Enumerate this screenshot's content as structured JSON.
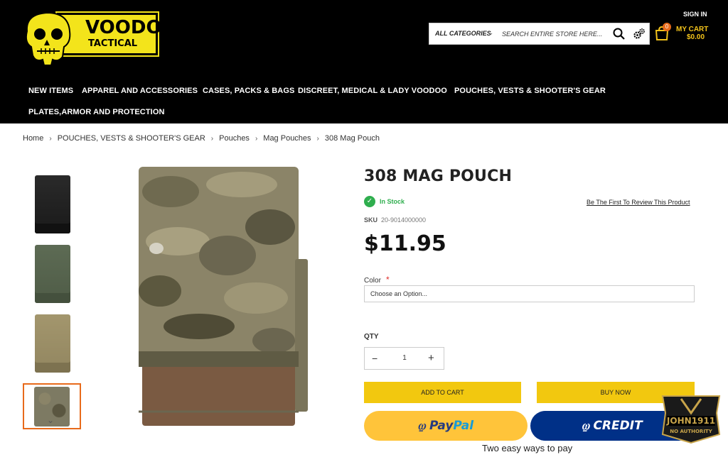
{
  "header": {
    "logo_line1": "VOODOO",
    "logo_line2": "TACTICAL",
    "search_category": "ALL CATEGORIES",
    "search_placeholder": "SEARCH ENTIRE STORE HERE...",
    "sign_in": "SIGN IN",
    "cart_count": "0",
    "cart_label": "MY CART",
    "cart_total": "$0.00"
  },
  "nav": [
    "NEW ITEMS",
    "APPAREL AND ACCESSORIES",
    "CASES, PACKS & BAGS",
    "DISCREET, MEDICAL & LADY VOODOO",
    "POUCHES, VESTS & SHOOTER'S GEAR",
    "PLATES,ARMOR AND PROTECTION"
  ],
  "breadcrumb": [
    "Home",
    "POUCHES, VESTS & SHOOTER'S GEAR",
    "Pouches",
    "Mag Pouches",
    "308 Mag Pouch"
  ],
  "product": {
    "title": "308 MAG POUCH",
    "stock": "In Stock",
    "review_link": "Be The First To Review This Product",
    "sku_label": "SKU",
    "sku": "20-9014000000",
    "price": "$11.95",
    "color_label": "Color",
    "color_required": "*",
    "color_placeholder": "Choose an Option...",
    "qty_label": "QTY",
    "qty": "1",
    "add_to_cart": "ADD TO CART",
    "buy_now": "BUY NOW",
    "paypal_a": "Pay",
    "paypal_b": "Pal",
    "credit": "CREDIT",
    "pay_caption": "Two easy ways to pay"
  },
  "thumbnails": [
    "black",
    "olive",
    "coyote",
    "multicam"
  ],
  "colors": {
    "header_bg": "#000000",
    "logo_yellow": "#f3e41b",
    "cart_yellow": "#f3c31b",
    "button_yellow": "#f2c80f",
    "paypal_yellow": "#ffc43a",
    "paypal_blue": "#003087",
    "in_stock_green": "#2fae4e",
    "accent_orange": "#e86a1b"
  },
  "watermark": {
    "line1": "JOHN1911",
    "line2": "NO AUTHORITY"
  }
}
